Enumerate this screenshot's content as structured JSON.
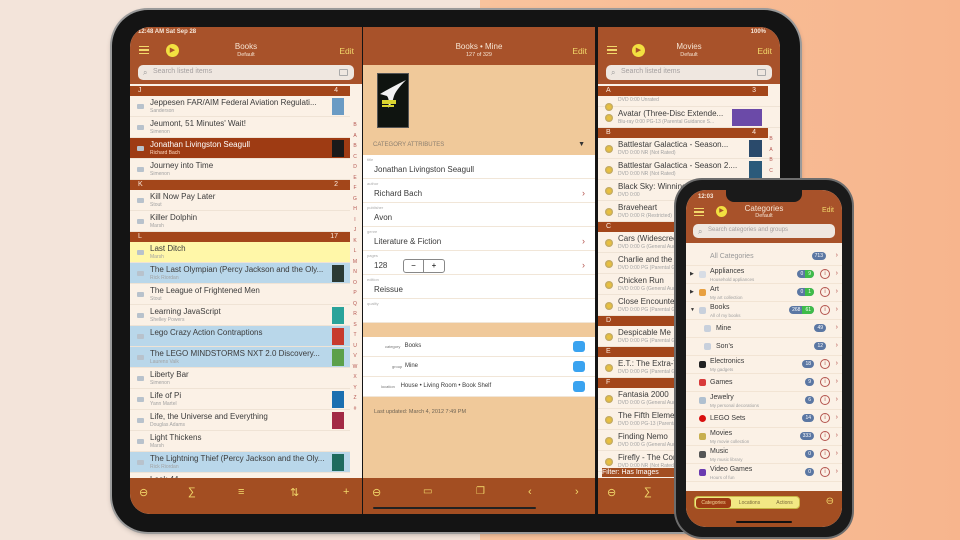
{
  "colors": {
    "brand": "#a8522a",
    "section": "#a3461a",
    "accent": "#f2d86a",
    "selected": "#9e3b13",
    "highlight_yellow": "#fff7a8",
    "highlight_blue": "#b9d7ea"
  },
  "books": {
    "status_time": "12:48 AM  Sat Sep 28",
    "title": "Books",
    "subtitle": "Default",
    "edit_label": "Edit",
    "search_placeholder": "Search listed items",
    "sections": [
      {
        "letter": "J",
        "count": "4"
      },
      {
        "letter": "K",
        "count": "2"
      },
      {
        "letter": "L",
        "count": "17"
      }
    ],
    "items": [
      {
        "title": "Jeppesen FAR/AIM Federal Aviation Regulati...",
        "author": "Sanderson"
      },
      {
        "title": "Jeumont, 51 Minutes' Wait!",
        "author": "Simenon"
      },
      {
        "title": "Jonathan Livingston Seagull",
        "author": "Richard Bach"
      },
      {
        "title": "Journey into Time",
        "author": "Simenon"
      },
      {
        "title": "Kill Now  Pay Later",
        "author": "Stout"
      },
      {
        "title": "Killer Dolphin",
        "author": "Marsh"
      },
      {
        "title": "Last Ditch",
        "author": "Marsh"
      },
      {
        "title": "The Last Olympian (Percy Jackson and the Oly...",
        "author": "Rick Riordan"
      },
      {
        "title": "The League of Frightened Men",
        "author": "Stout"
      },
      {
        "title": "Learning JavaScript",
        "author": "Shelley Powers"
      },
      {
        "title": "Lego Crazy Action Contraptions",
        "author": ""
      },
      {
        "title": "The LEGO MINDSTORMS NXT 2.0 Discovery...",
        "author": "Laurens Valk"
      },
      {
        "title": "Liberty Bar",
        "author": "Simenon"
      },
      {
        "title": "Life of Pi",
        "author": "Yann Martel"
      },
      {
        "title": "Life, the Universe and Everything",
        "author": "Douglas Adams"
      },
      {
        "title": "Light Thickens",
        "author": "Marsh"
      },
      {
        "title": "The Lightning Thief (Percy Jackson and the Oly...",
        "author": "Rick Riordan"
      },
      {
        "title": "Look 44",
        "author": ""
      }
    ],
    "index": [
      "B",
      "A",
      "B",
      "C",
      "D",
      "E",
      "F",
      "G",
      "H",
      "I",
      "J",
      "K",
      "L",
      "M",
      "N",
      "O",
      "P",
      "Q",
      "R",
      "S",
      "T",
      "U",
      "V",
      "W",
      "X",
      "Y",
      "Z",
      "#"
    ],
    "toolbar": {
      "minus": "⊖",
      "sum": "∑",
      "filter": "≡",
      "sort": "⇅",
      "add": "+"
    }
  },
  "detail": {
    "title": "Books • Mine",
    "subtitle": "127 of 329",
    "edit_label": "Edit",
    "attributes_header": "CATEGORY ATTRIBUTES",
    "attributes": [
      {
        "label": "title",
        "value": "Jonathan Livingston Seagull",
        "chevron": false
      },
      {
        "label": "author",
        "value": "Richard Bach",
        "chevron": true
      },
      {
        "label": "publisher",
        "value": "Avon",
        "chevron": false
      },
      {
        "label": "genre",
        "value": "Literature & Fiction",
        "chevron": true
      },
      {
        "label": "pages",
        "value": "128",
        "chevron": true
      },
      {
        "label": "edition",
        "value": "Reissue",
        "chevron": false
      },
      {
        "label": "quality",
        "value": "",
        "chevron": false
      }
    ],
    "stepper": {
      "minus": "−",
      "plus": "+"
    },
    "location": [
      {
        "key": "category",
        "value": "Books"
      },
      {
        "key": "group",
        "value": "Mine"
      },
      {
        "key": "location",
        "value": "House • Living Room • Book Shelf"
      }
    ],
    "last_updated": "Last updated: March 4, 2012 7:49 PM"
  },
  "movies": {
    "status": "100%",
    "title": "Movies",
    "subtitle": "Default",
    "edit_label": "Edit",
    "search_placeholder": "Search listed items",
    "sections": [
      {
        "letter": "A",
        "count": "3"
      },
      {
        "letter": "B",
        "count": "4"
      },
      {
        "letter": "C",
        "count": ""
      },
      {
        "letter": "D",
        "count": ""
      },
      {
        "letter": "E",
        "count": ""
      },
      {
        "letter": "F",
        "count": ""
      }
    ],
    "items": [
      {
        "title": "",
        "sub": "DVD 0:00 Unrated"
      },
      {
        "title": "Avatar (Three-Disc Extende...",
        "sub": "Blu-ray 0:00 PG-13 (Parental Guidance S..."
      },
      {
        "title": "Battlestar Galactica  - Season...",
        "sub": "DVD 0:00 NR (Not Rated)"
      },
      {
        "title": "Battlestar Galactica - Season 2....",
        "sub": "DVD 0:00 NR (Not Rated)"
      },
      {
        "title": "Black Sky: Winning the X Prize",
        "sub": "DVD 0:00"
      },
      {
        "title": "Braveheart",
        "sub": "DVD 0:00 R (Restricted)"
      },
      {
        "title": "Cars (Widescreen)",
        "sub": "DVD 0:00 G (General Audiences)"
      },
      {
        "title": "Charlie and the Chocolate Factory",
        "sub": "DVD 0:00 PG (Parental Guidance)"
      },
      {
        "title": "Chicken Run",
        "sub": "DVD 0:00 G (General Audiences)"
      },
      {
        "title": "Close Encounters",
        "sub": "DVD 0:00 PG (Parental Guidance)"
      },
      {
        "title": "Despicable Me",
        "sub": "DVD 0:00 PG (Parental Guidance)"
      },
      {
        "title": "E.T.: The Extra-Terrestrial",
        "sub": "DVD 0:00 PG (Parental Guidance)"
      },
      {
        "title": "Fantasia 2000",
        "sub": "DVD 0:00 G (General Audiences)"
      },
      {
        "title": "The Fifth Element",
        "sub": "DVD 0:00 PG-13 (Parental Guidance)"
      },
      {
        "title": "Finding Nemo",
        "sub": "DVD 0:00 G (General Audiences)"
      },
      {
        "title": "Firefly - The Complete Series",
        "sub": "DVD 0:00 NR (Not Rated)"
      }
    ],
    "index": [
      "B",
      "A",
      "B",
      "C",
      "D",
      "E"
    ],
    "filter_label": "Filter: Has Images",
    "toolbar": {
      "minus": "⊖",
      "sum": "∑"
    }
  },
  "categories": {
    "status_time": "12:03",
    "title": "Categories",
    "subtitle": "Default",
    "edit_label": "Edit",
    "search_placeholder": "Search categories and groups",
    "all": {
      "label": "All Categories",
      "count": "713"
    },
    "items": [
      {
        "name": "Appliances",
        "desc": "Household appliances",
        "count": "0",
        "green": "9",
        "expand": "▶"
      },
      {
        "name": "Art",
        "desc": "My art collection",
        "count": "0",
        "green": "1",
        "expand": "▶"
      },
      {
        "name": "Books",
        "desc": "All of my books",
        "count": "268",
        "green": "61",
        "expand": "▼"
      },
      {
        "name": "Mine",
        "desc": "",
        "count": "49",
        "green": "",
        "expand": ""
      },
      {
        "name": "Son's",
        "desc": "",
        "count": "12",
        "green": "",
        "expand": ""
      },
      {
        "name": "Electronics",
        "desc": "My gadgets",
        "count": "18",
        "green": "",
        "expand": ""
      },
      {
        "name": "Games",
        "desc": "",
        "count": "9",
        "green": "",
        "expand": ""
      },
      {
        "name": "Jewelry",
        "desc": "My personal decorations",
        "count": "6",
        "green": "",
        "expand": ""
      },
      {
        "name": "LEGO Sets",
        "desc": "",
        "count": "14",
        "green": "",
        "expand": ""
      },
      {
        "name": "Movies",
        "desc": "My movie collection",
        "count": "333",
        "green": "",
        "expand": ""
      },
      {
        "name": "Music",
        "desc": "My music library",
        "count": "0",
        "green": "",
        "expand": ""
      },
      {
        "name": "Video Games",
        "desc": "Hours of fun",
        "count": "0",
        "green": "",
        "expand": ""
      }
    ],
    "segments": [
      "Categories",
      "Locations",
      "Actions"
    ],
    "active_segment": "Categories"
  }
}
